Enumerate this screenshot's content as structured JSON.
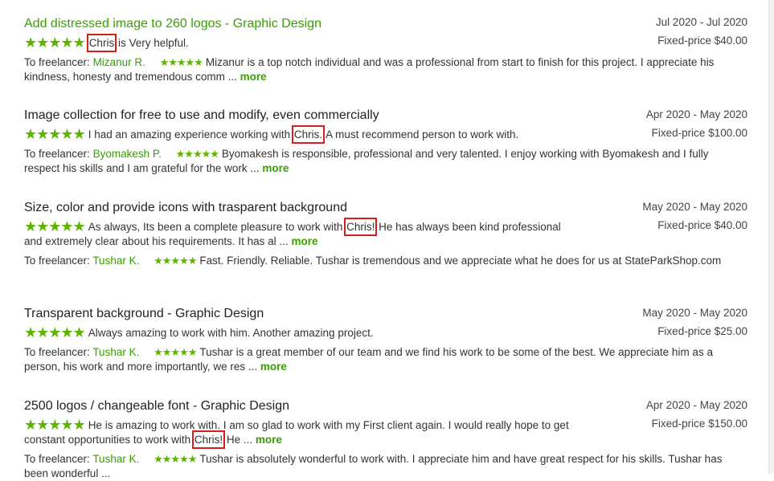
{
  "items": [
    {
      "title": "Add distressed image to 260 logos - Graphic Design",
      "date_range": "Jul 2020 - Jul 2020",
      "price": "Fixed-price $40.00",
      "client_rating": 5,
      "client_review": {
        "before": "",
        "highlight": "Chris",
        "after": " is Very helpful."
      },
      "freelancer_label": "To freelancer:",
      "freelancer_name": "Mizanur R.",
      "freelancer_rating": 5,
      "freelancer_review": "Mizanur is a top notch individual and was a professional from start to finish for this project. I appreciate his kindness, honesty and tremendous comm ...",
      "more_label": "more"
    },
    {
      "title": "Image collection for free to use and modify, even commercially",
      "date_range": "Apr 2020 - May 2020",
      "price": "Fixed-price $100.00",
      "client_rating": 5,
      "client_review": {
        "before": "I had an amazing experience working with ",
        "highlight": "Chris.",
        "after": " A must recommend person to work with."
      },
      "freelancer_label": "To freelancer:",
      "freelancer_name": "Byomakesh P.",
      "freelancer_rating": 5,
      "freelancer_review": "Byomakesh is responsible, professional and very talented. I enjoy working with Byomakesh and I fully respect his skills and I am grateful for the work ...",
      "more_label": "more"
    },
    {
      "title": "Size, color and provide icons with trasparent background",
      "date_range": "May 2020 - May 2020",
      "price": "Fixed-price $40.00",
      "client_rating": 5,
      "client_review": {
        "before": "As always, Its been a complete pleasure to work with ",
        "highlight": "Chris!",
        "after": " He has always been kind professional and extremely clear about his requirements. It has al ...",
        "more_label": "more"
      },
      "freelancer_label": "To freelancer:",
      "freelancer_name": "Tushar K.",
      "freelancer_rating": 5,
      "freelancer_review": "Fast. Friendly. Reliable. Tushar is tremendous and we appreciate what he does for us at StateParkShop.com"
    },
    {
      "title": "Transparent background - Graphic Design",
      "date_range": "May 2020 - May 2020",
      "price": "Fixed-price $25.00",
      "client_rating": 5,
      "client_review": {
        "before": "Always amazing to work with him. Another amazing project.",
        "highlight": "",
        "after": ""
      },
      "freelancer_label": "To freelancer:",
      "freelancer_name": "Tushar K.",
      "freelancer_rating": 5,
      "freelancer_review": "Tushar is a great member of our team and we find his work to be some of the best. We appreciate him as a person, his work and more importantly, we res ...",
      "more_label": "more"
    },
    {
      "title": "2500 logos / changeable font - Graphic Design",
      "date_range": "Apr 2020 - May 2020",
      "price": "Fixed-price $150.00",
      "client_rating": 5,
      "client_review": {
        "before": "He is amazing to work with. I am so glad to work with my First client again. I would really hope to get constant opportunities to work with ",
        "highlight": "Chris!",
        "after": " He ...",
        "more_label": "more"
      },
      "freelancer_label": "To freelancer:",
      "freelancer_name": "Tushar K.",
      "freelancer_rating": 5,
      "freelancer_review": "Tushar is absolutely wonderful to work with. I appreciate him and have great respect for his skills. Tushar has been wonderful ..."
    }
  ],
  "star_glyph": "★",
  "colors": {
    "accent": "#37a000",
    "star": "#5cb300",
    "highlight_box": "#d91c1c"
  }
}
